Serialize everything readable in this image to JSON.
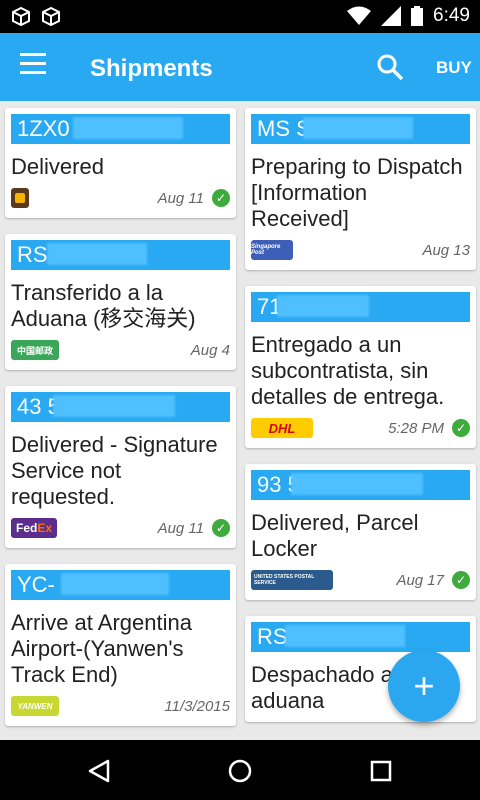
{
  "status_bar": {
    "time": "6:49"
  },
  "app_bar": {
    "title": "Shipments",
    "buy_label": "BUY"
  },
  "colors": {
    "primary": "#28a9f1",
    "check": "#3dac3d"
  },
  "left_cards": [
    {
      "tracking": "1ZX0        59 20",
      "status": "Delivered",
      "carrier": "UPS",
      "date": "Aug 11",
      "delivered": true
    },
    {
      "tracking": "RS        CN",
      "status": "Transferido a la Aduana (移交海关)",
      "carrier": "China Post",
      "date": "Aug 4",
      "delivered": false
    },
    {
      "tracking": "43        53",
      "status": "Delivered - Signature Service not requested.",
      "carrier": "FedEx",
      "date": "Aug 11",
      "delivered": true
    },
    {
      "tracking": "YC-        -YW",
      "status": "Arrive at Argentina Airport-(Yanwen's Track End)",
      "carrier": "YANWEN",
      "date": "11/3/2015",
      "delivered": false
    }
  ],
  "right_cards": [
    {
      "tracking": "MS        SG",
      "status": "Preparing to Dispatch [Information Received]",
      "carrier": "Singapore Post",
      "date": "Aug 13",
      "delivered": false
    },
    {
      "tracking": "71        26",
      "status": "Entregado a un subcontratista, sin detalles de entrega.",
      "carrier": "DHL",
      "date": "5:28 PM",
      "delivered": true
    },
    {
      "tracking": "93        51        86",
      "status": "Delivered, Parcel Locker",
      "carrier": "UNITED STATES POSTAL SERVICE",
      "date": "Aug 17",
      "delivered": true
    },
    {
      "tracking": "RS        7",
      "status": "Despachado a aduana",
      "carrier": "",
      "date": "",
      "delivered": false
    }
  ],
  "fab": {
    "label": "+"
  }
}
